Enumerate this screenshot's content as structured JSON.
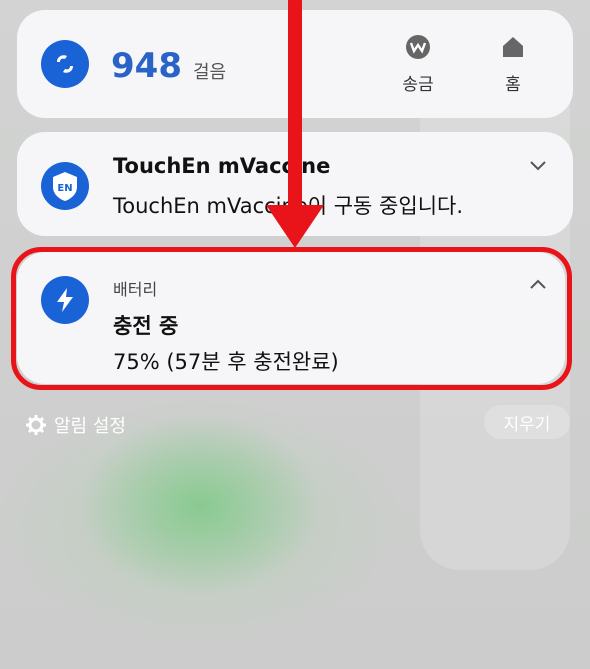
{
  "steps": {
    "value": "948",
    "unit": "걸음"
  },
  "quick_actions": [
    {
      "label": "송금"
    },
    {
      "label": "홈"
    }
  ],
  "touchen": {
    "title": "TouchEn mVaccine",
    "message": "TouchEn mVaccine이 구동 중입니다."
  },
  "battery": {
    "app": "배터리",
    "title": "충전 중",
    "message": "75% (57분 후 충전완료)"
  },
  "footer": {
    "settings": "알림 설정",
    "clear": "지우기"
  },
  "colors": {
    "accent": "#1a63d6",
    "highlight": "#e8141a"
  }
}
